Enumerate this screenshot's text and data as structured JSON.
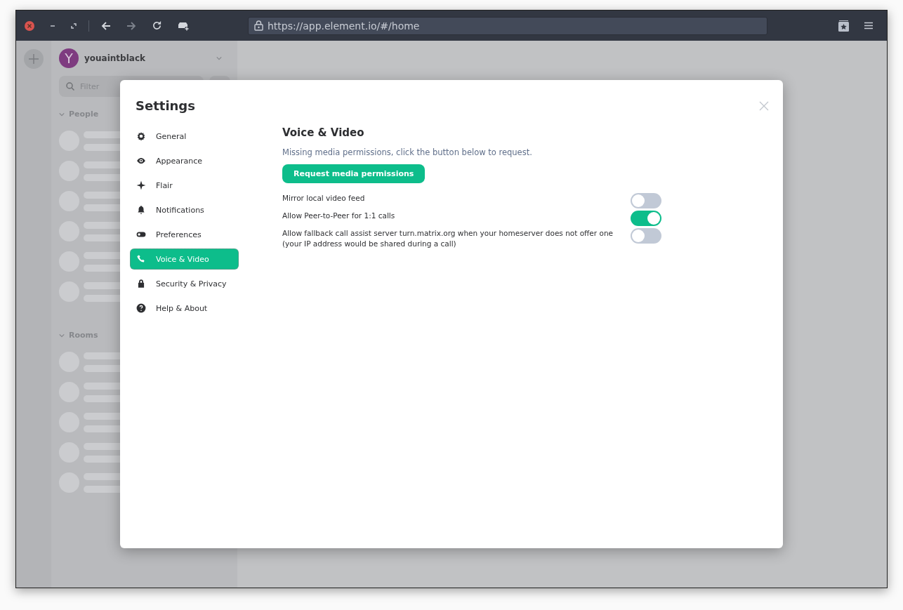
{
  "browser": {
    "url": "https://app.element.io/#/home"
  },
  "sidebar": {
    "user": {
      "initial": "Y",
      "name": "youaintblack"
    },
    "filter": {
      "placeholder": "Filter"
    },
    "sections": [
      {
        "label": "People",
        "expanded": true
      },
      {
        "label": "Rooms",
        "expanded": true
      }
    ]
  },
  "dialog": {
    "title": "Settings",
    "tabs": [
      {
        "kind": "gear",
        "label": "General",
        "selected": false
      },
      {
        "kind": "eye",
        "label": "Appearance",
        "selected": false
      },
      {
        "kind": "sparkle",
        "label": "Flair",
        "selected": false
      },
      {
        "kind": "bell",
        "label": "Notifications",
        "selected": false
      },
      {
        "kind": "toggle",
        "label": "Preferences",
        "selected": false
      },
      {
        "kind": "phone",
        "label": "Voice & Video",
        "selected": true
      },
      {
        "kind": "lock",
        "label": "Security & Privacy",
        "selected": false
      },
      {
        "kind": "help",
        "label": "Help & About",
        "selected": false
      }
    ],
    "heading": "Voice & Video",
    "notice": "Missing media permissions, click the button below to request.",
    "button": "Request media permissions",
    "toggles": [
      {
        "label": "Mirror local video feed",
        "on": false
      },
      {
        "label": "Allow Peer-to-Peer for 1:1 calls",
        "on": true
      },
      {
        "label": "Allow fallback call assist server turn.matrix.org when your homeserver does not offer one (your IP address would be shared during a call)",
        "on": false
      }
    ]
  }
}
